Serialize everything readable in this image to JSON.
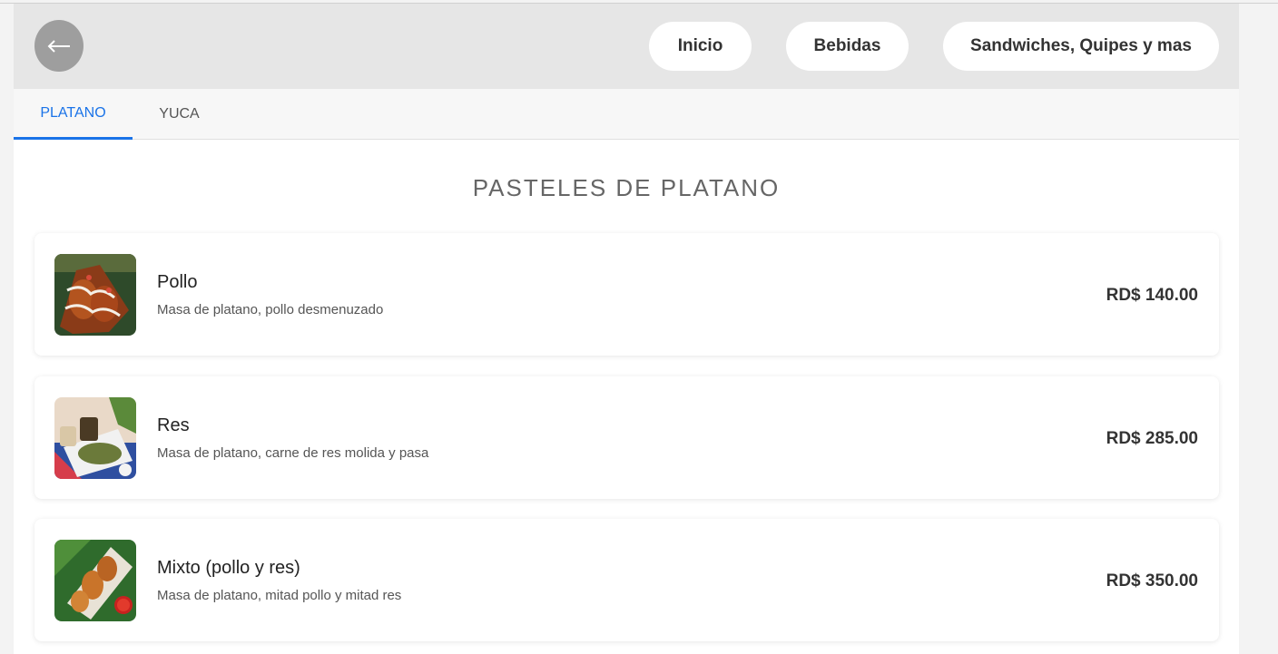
{
  "header": {
    "back_icon": "arrow-left-icon",
    "nav": [
      {
        "label": "Inicio"
      },
      {
        "label": "Bebidas"
      },
      {
        "label": "Sandwiches, Quipes y mas"
      }
    ]
  },
  "tabs": [
    {
      "label": "PLATANO",
      "active": true
    },
    {
      "label": "YUCA",
      "active": false
    }
  ],
  "section": {
    "title": "PASTELES DE PLATANO"
  },
  "items": [
    {
      "name": "Pollo",
      "description": "Masa de platano, pollo desmenuzado",
      "price": "RD$ 140.00"
    },
    {
      "name": "Res",
      "description": "Masa de platano, carne de res molida y pasa",
      "price": "RD$ 285.00"
    },
    {
      "name": "Mixto (pollo y res)",
      "description": "Masa de platano, mitad pollo y mitad res",
      "price": "RD$ 350.00"
    }
  ],
  "colors": {
    "accent": "#1a73e8",
    "header_bg": "#e6e6e6",
    "back_button": "#9e9e9e"
  }
}
